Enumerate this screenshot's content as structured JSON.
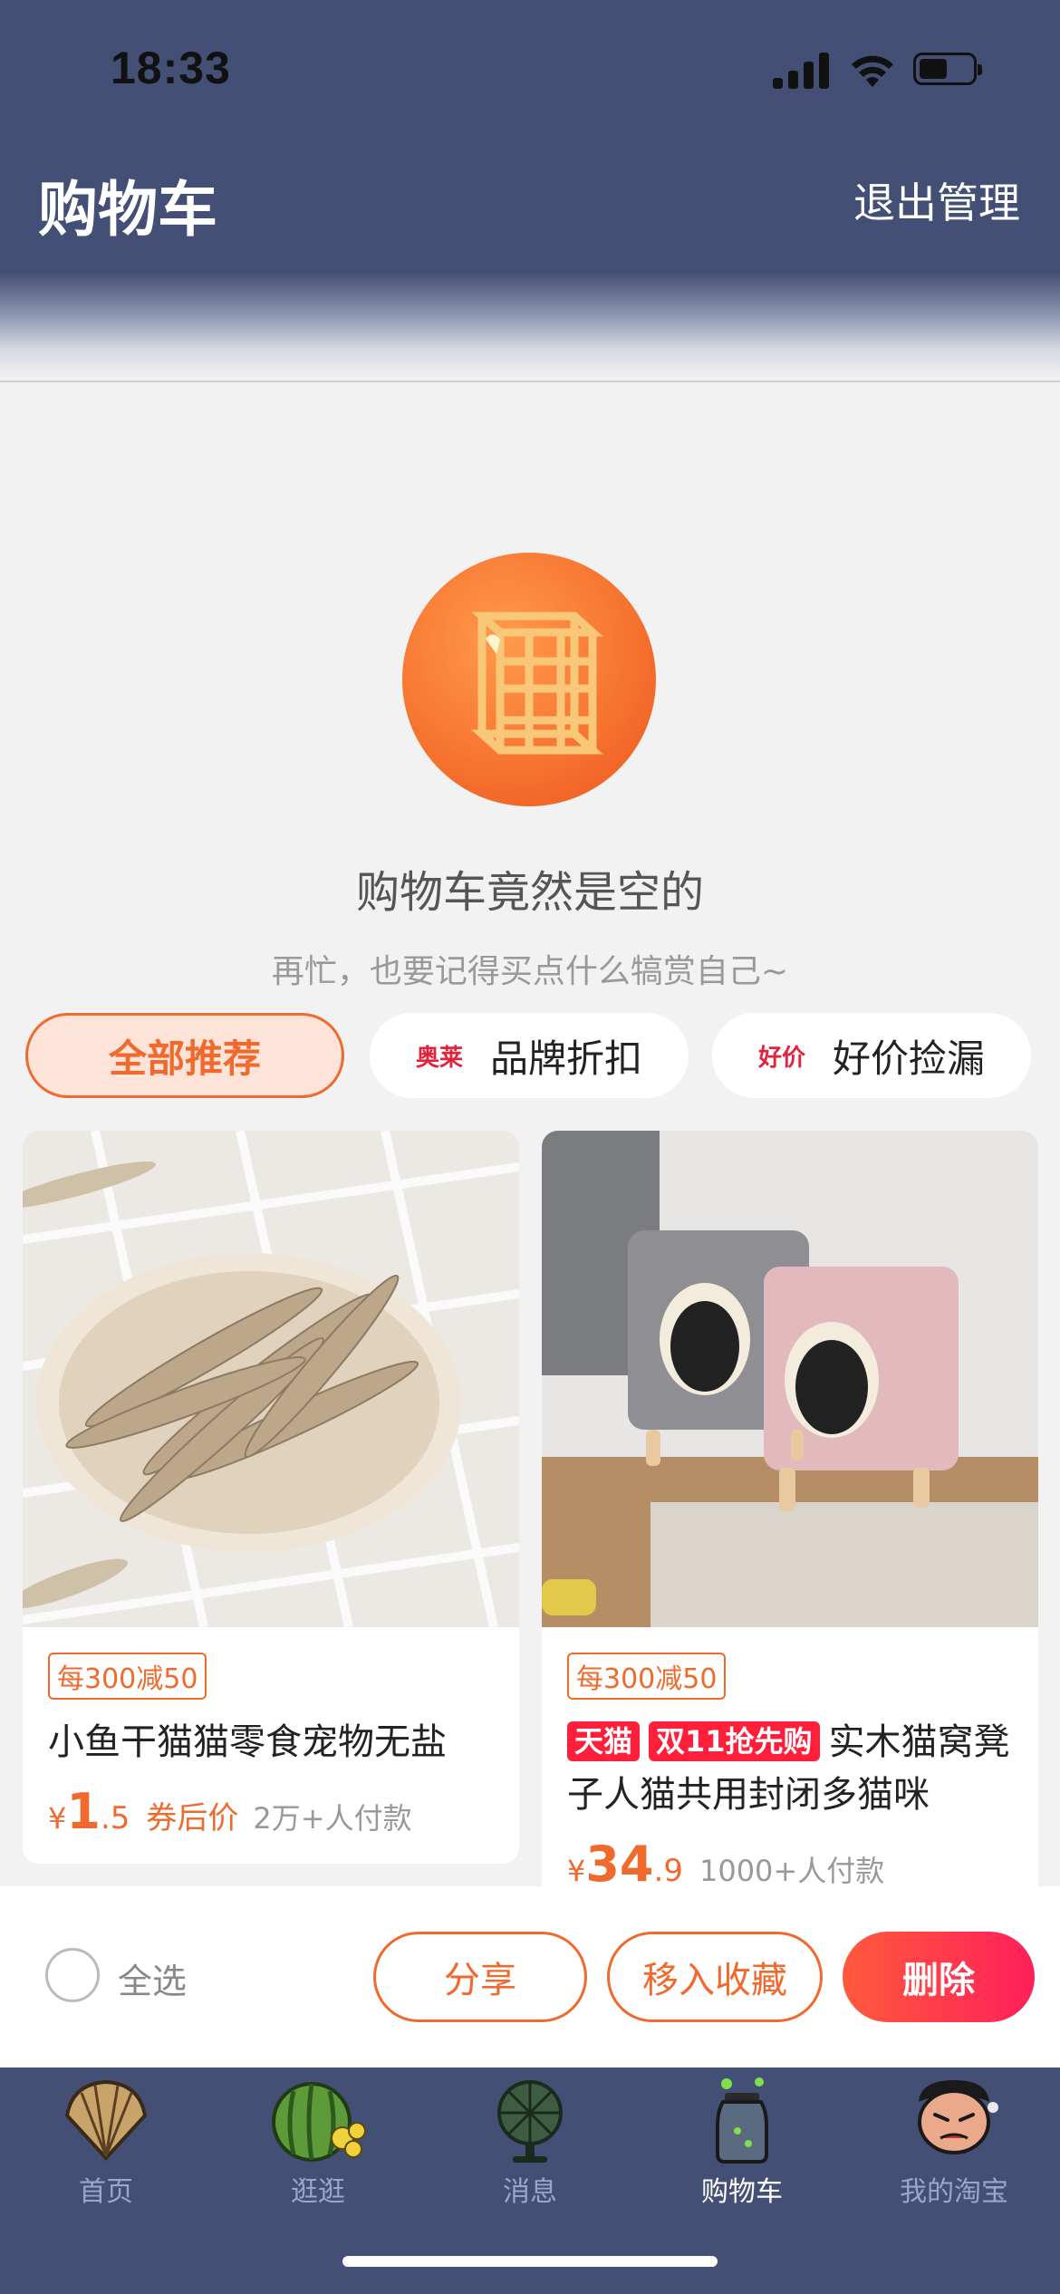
{
  "status_bar": {
    "time": "18:33"
  },
  "header": {
    "title": "购物车",
    "exit_manage": "退出管理"
  },
  "empty_state": {
    "title": "购物车竟然是空的",
    "subtitle": "再忙，也要记得买点什么犒赏自己~"
  },
  "tabs": [
    {
      "label": "全部推荐",
      "tag": "",
      "active": true
    },
    {
      "label": "品牌折扣",
      "tag": "奥莱",
      "active": false
    },
    {
      "label": "好价捡漏",
      "tag": "好价",
      "active": false
    }
  ],
  "products": [
    {
      "coupon": "每300减50",
      "badges": [],
      "name": "小鱼干猫猫零食宠物无盐",
      "currency": "¥",
      "price_int": "1",
      "price_dec": ".5",
      "price_label": "券后价",
      "sold": "2万+人付款"
    },
    {
      "coupon": "每300减50",
      "badges": [
        "天猫",
        "双11抢先购"
      ],
      "name": "实木猫窝凳子人猫共用封闭多猫咪",
      "currency": "¥",
      "price_int": "34",
      "price_dec": ".9",
      "price_label": "",
      "sold": "1000+人付款"
    }
  ],
  "action_bar": {
    "select_all": "全选",
    "share": "分享",
    "favorite": "移入收藏",
    "delete": "删除"
  },
  "tab_bar": [
    {
      "label": "首页",
      "icon": "shell-icon",
      "active": false
    },
    {
      "label": "逛逛",
      "icon": "watermelon-icon",
      "active": false
    },
    {
      "label": "消息",
      "icon": "fan-icon",
      "active": false
    },
    {
      "label": "购物车",
      "icon": "jar-icon",
      "active": true
    },
    {
      "label": "我的淘宝",
      "icon": "face-icon",
      "active": false
    }
  ],
  "colors": {
    "header_bg": "#434f75",
    "accent": "#f06a2d",
    "delete": "#ff1f5a"
  }
}
